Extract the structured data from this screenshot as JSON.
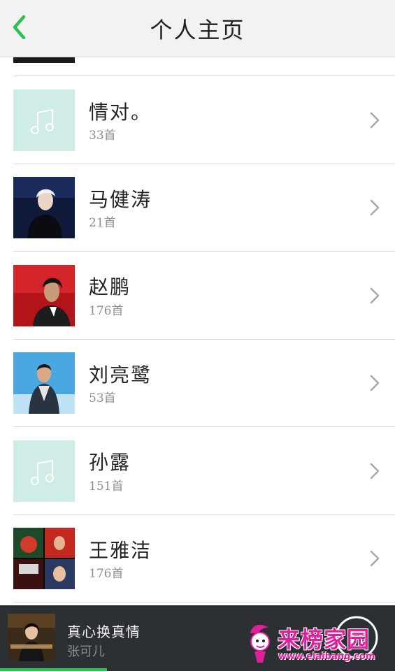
{
  "header": {
    "title": "个人主页",
    "back_icon": "chevron-left-icon",
    "accent": "#2fbf52"
  },
  "artists": [
    {
      "name": "情对。",
      "count": "33首",
      "cover": "placeholder"
    },
    {
      "name": "马健涛",
      "count": "21首",
      "cover": "photo"
    },
    {
      "name": "赵鹏",
      "count": "176首",
      "cover": "photo"
    },
    {
      "name": "刘亮鹭",
      "count": "53首",
      "cover": "photo"
    },
    {
      "name": "孙露",
      "count": "151首",
      "cover": "placeholder"
    },
    {
      "name": "王雅洁",
      "count": "176首",
      "cover": "photo"
    }
  ],
  "player": {
    "title": "真心换真情",
    "artist": "张可儿",
    "progress_fraction": 0.27
  },
  "watermark": {
    "text": "来榜家园",
    "url": "www.elaibang.com"
  },
  "colors": {
    "placeholder_bg": "#cfece6",
    "player_bg": "#2c2f33",
    "progress": "#2fbf52"
  }
}
